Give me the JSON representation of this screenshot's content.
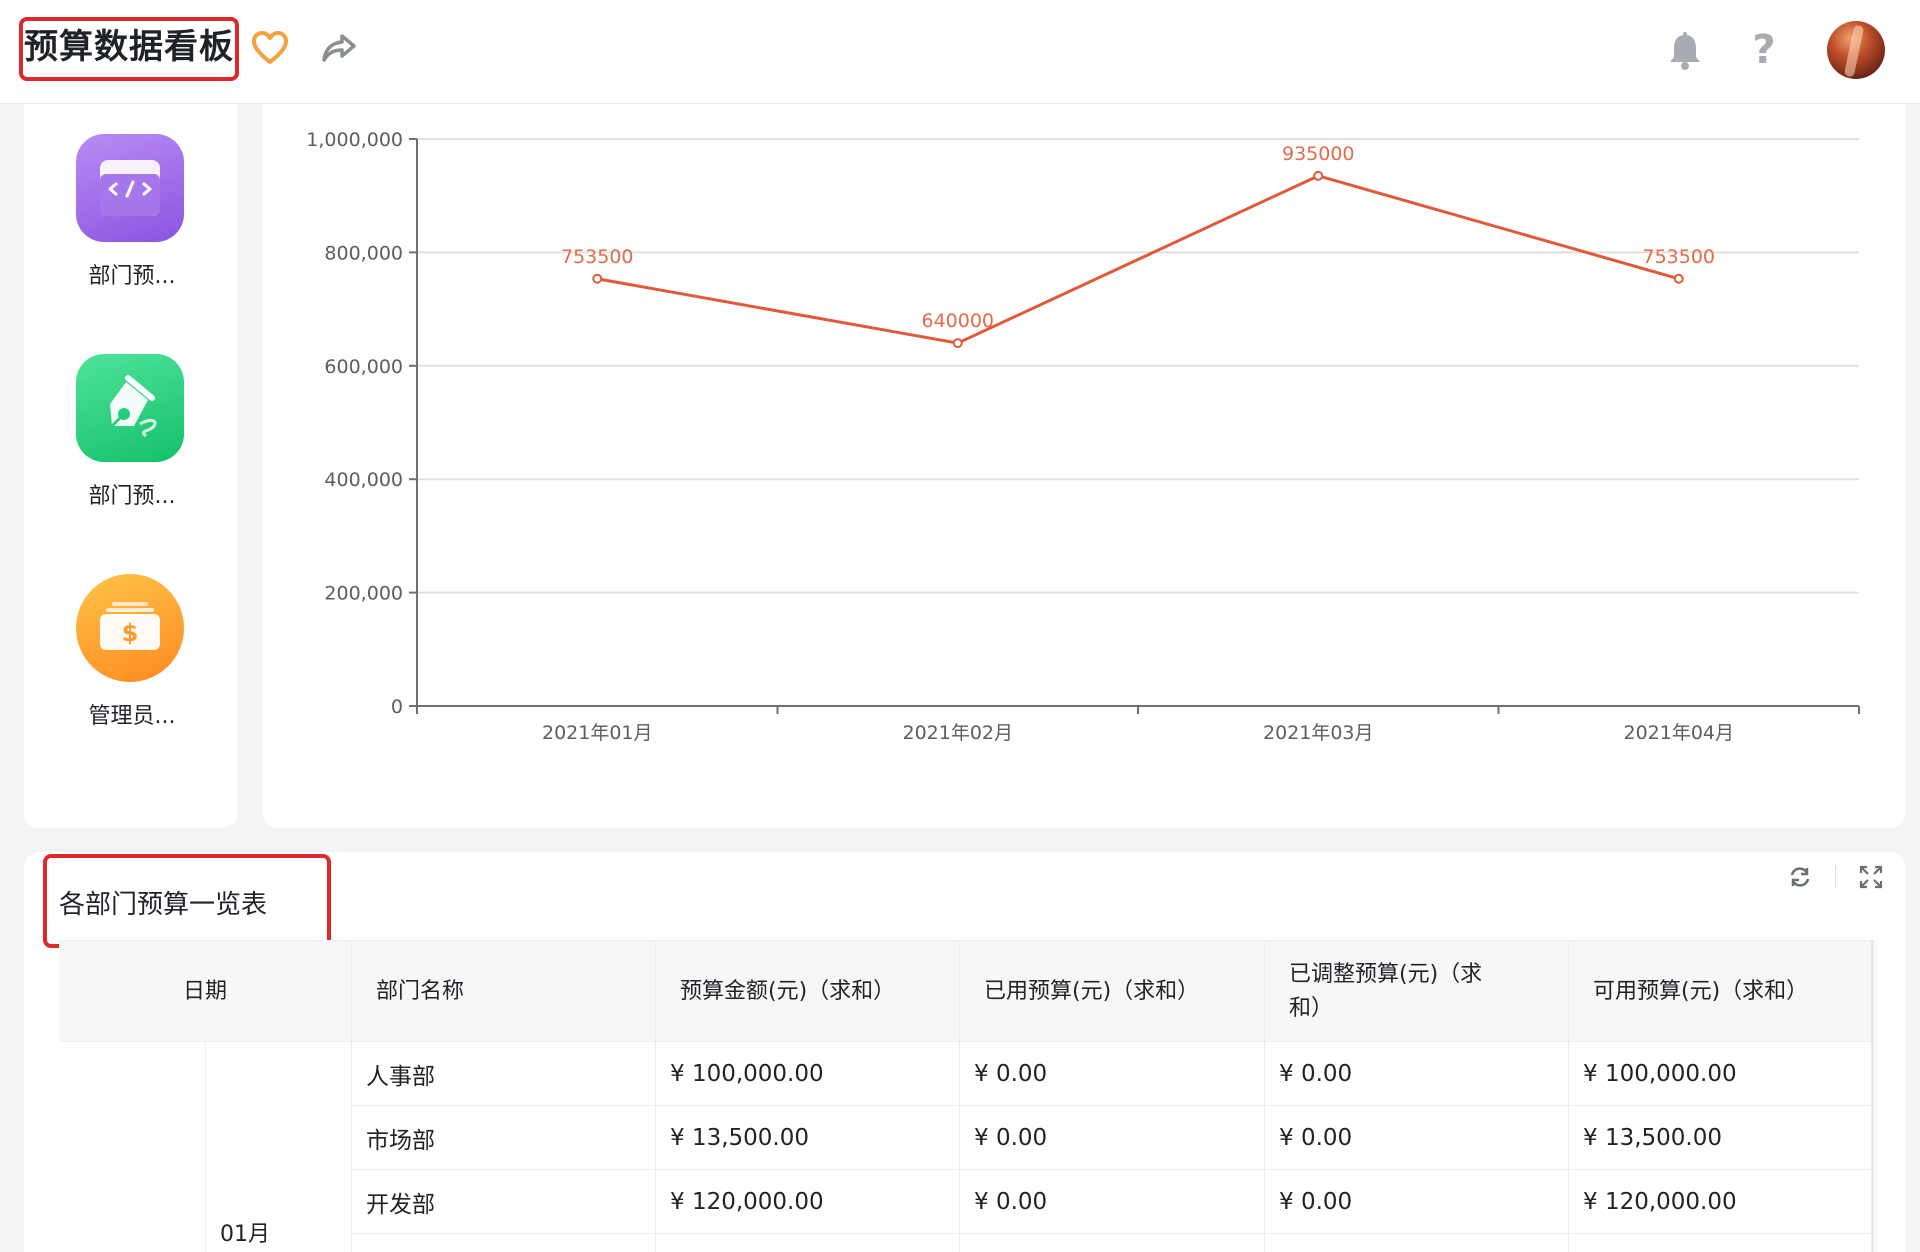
{
  "header": {
    "title": "预算数据看板"
  },
  "apps": [
    {
      "label": "部门预...",
      "icon": "code-window-icon",
      "color": "#9b6ae8"
    },
    {
      "label": "部门预...",
      "icon": "pen-nib-icon",
      "color": "#22cf7a"
    },
    {
      "label": "管理员...",
      "icon": "money-card-icon",
      "color": "#ffa22e"
    }
  ],
  "chart_data": {
    "type": "line",
    "categories": [
      "2021年01月",
      "2021年02月",
      "2021年03月",
      "2021年04月"
    ],
    "values": [
      753500,
      640000,
      935000,
      753500
    ],
    "data_labels": [
      "753500",
      "640000",
      "935000",
      "753500"
    ],
    "ylim": [
      0,
      1000000
    ],
    "yticks": [
      0,
      200000,
      400000,
      600000,
      800000,
      1000000
    ],
    "ytick_labels": [
      "0",
      "200,000",
      "400,000",
      "600,000",
      "800,000",
      "1,000,000"
    ],
    "grid": true,
    "line_color": "#e05a3a",
    "label_color": "#e66a4a"
  },
  "table": {
    "title": "各部门预算一览表",
    "columns": [
      "日期",
      "部门名称",
      "预算金额(元)（求和）",
      "已用预算(元)（求和）",
      "已调整预算(元)（求和）",
      "可用预算(元)（求和）"
    ],
    "month": "01月",
    "rows": [
      [
        "人事部",
        "¥ 100,000.00",
        "¥ 0.00",
        "¥ 0.00",
        "¥ 100,000.00"
      ],
      [
        "市场部",
        "¥ 13,500.00",
        "¥ 0.00",
        "¥ 0.00",
        "¥ 13,500.00"
      ],
      [
        "开发部",
        "¥ 120,000.00",
        "¥ 0.00",
        "¥ 0.00",
        "¥ 120,000.00"
      ]
    ]
  },
  "colors": {
    "accent_red": "#e02828",
    "heart": "#f5a142",
    "icon_gray": "#a8abb2"
  }
}
